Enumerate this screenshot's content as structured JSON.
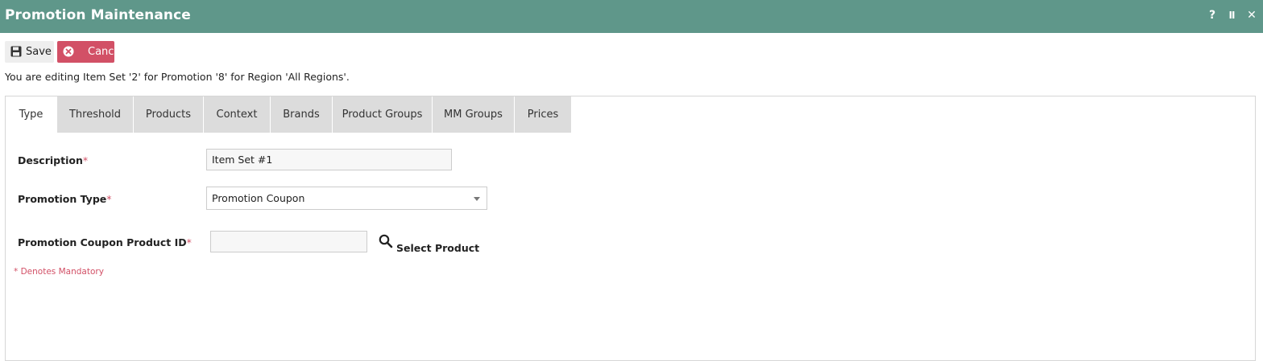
{
  "window": {
    "title": "Promotion Maintenance",
    "controls": {
      "help": "?",
      "pause": "II",
      "close": "✕"
    }
  },
  "toolbar": {
    "save_label": "Save",
    "cancel_label": "Cancel"
  },
  "edit_message": "You are editing Item Set '2' for Promotion '8' for Region 'All Regions'.",
  "tabs": [
    {
      "label": "Type",
      "active": true
    },
    {
      "label": "Threshold"
    },
    {
      "label": "Products"
    },
    {
      "label": "Context"
    },
    {
      "label": "Brands"
    },
    {
      "label": "Product Groups"
    },
    {
      "label": "MM Groups"
    },
    {
      "label": "Prices"
    }
  ],
  "form": {
    "description": {
      "label": "Description",
      "required_mark": "*",
      "value": "Item Set #1"
    },
    "promotion_type": {
      "label": "Promotion Type",
      "required_mark": "*",
      "selected": "Promotion Coupon"
    },
    "coupon_product": {
      "label": "Promotion Coupon Product ID",
      "required_mark": "*",
      "value": "",
      "select_label": "Select Product"
    },
    "mandatory_note": "* Denotes Mandatory"
  },
  "colors": {
    "titlebar": "#5f978a",
    "cancel": "#d25066",
    "required": "#d25066"
  },
  "icons": {
    "save": "floppy-disk-icon",
    "cancel": "x-circle-icon",
    "search": "magnifier-icon"
  }
}
